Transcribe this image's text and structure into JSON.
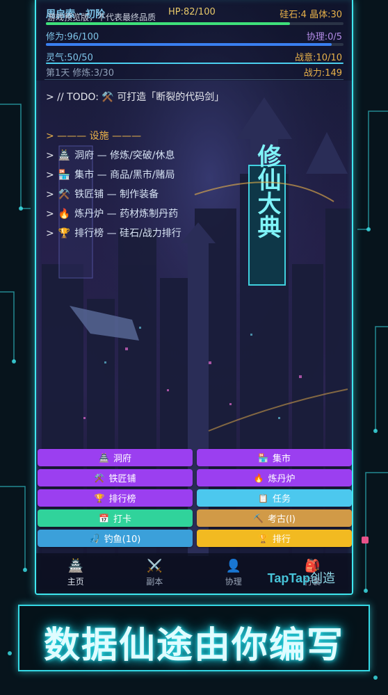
{
  "hud": {
    "name_realm": "周启索 · 初阶",
    "preview_note": "游戏预览版，不代表最终品质",
    "hp_text": "HP:82/100",
    "currency_text": "硅石:4 晶体:30",
    "cultivation_text": "修为:96/100",
    "protocol_text": "协理:0/5",
    "spirit_text": "灵气:50/50",
    "war_intent_text": "战意:10/10",
    "day_text": "第1天 修炼:3/30",
    "power_text": "战力:149",
    "hp_fraction": 0.82,
    "cultivation_fraction": 0.96,
    "spirit_fraction": 1.0
  },
  "console": {
    "todo_line": "> // TODO: ⚒️ 可打造「断裂的代码剑」",
    "section_header": "> ——— 设施 ———",
    "lines": [
      {
        "icon": "🏯",
        "text": "洞府 — 修炼/突破/休息"
      },
      {
        "icon": "🏪",
        "text": "集市 — 商品/黑市/赌局"
      },
      {
        "icon": "⚒️",
        "text": "铁匠铺 — 制作装备"
      },
      {
        "icon": "🔥",
        "text": "炼丹炉 — 药材炼制丹药"
      },
      {
        "icon": "🏆",
        "text": "排行榜 — 硅石/战力排行"
      }
    ]
  },
  "buttons": [
    {
      "icon": "🏯",
      "label": "洞府",
      "color": "#9b3ff0"
    },
    {
      "icon": "🏪",
      "label": "集市",
      "color": "#9b3ff0"
    },
    {
      "icon": "⚒️",
      "label": "铁匠铺",
      "color": "#9b3ff0"
    },
    {
      "icon": "🔥",
      "label": "炼丹炉",
      "color": "#9b3ff0"
    },
    {
      "icon": "🏆",
      "label": "排行榜",
      "color": "#9b3ff0"
    },
    {
      "icon": "📋",
      "label": "任务",
      "color": "#4cc8ee"
    },
    {
      "icon": "📅",
      "label": "打卡",
      "color": "#30d39b"
    },
    {
      "icon": "⛏️",
      "label": "考古(I)",
      "color": "#d19a47"
    },
    {
      "icon": "🎣",
      "label": "钓鱼(10)",
      "color": "#3ba0da"
    },
    {
      "icon": "🏆",
      "label": "排行",
      "color": "#f2ba21"
    }
  ],
  "tabs": [
    {
      "icon": "🏯",
      "label": "主页"
    },
    {
      "icon": "⚔️",
      "label": "副本"
    },
    {
      "icon": "👤",
      "label": "协理"
    },
    {
      "icon": "🎒",
      "label": "行囊"
    }
  ],
  "watermark": {
    "brand": "TapTap",
    "suffix": "创造"
  },
  "banner": {
    "text": "数据仙途由你编写"
  },
  "background": {
    "sign_text": "修仙大典",
    "colors": {
      "sky": "#1c1b3d",
      "glow": "#2fe3ef",
      "accent": "#e9b24a"
    }
  }
}
